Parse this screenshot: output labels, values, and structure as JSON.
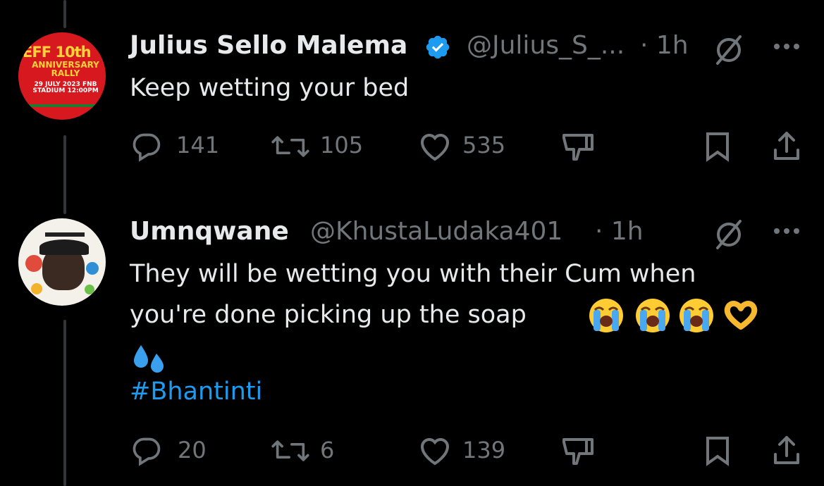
{
  "tweets": [
    {
      "display_name": "Julius Sello Malema",
      "verified": true,
      "handle": "@Julius_S_...",
      "time": "· 1h",
      "text": "Keep wetting your bed",
      "avatar_text": {
        "line1": "EFF 10th",
        "line2": "ANNIVERSARY RALLY",
        "line3": "29 JULY 2023 FNB STADIUM 12:00PM"
      },
      "replies": "141",
      "retweets": "105",
      "likes": "535"
    },
    {
      "display_name": "Umnqwane",
      "verified": false,
      "handle": "@KhustaLudaka401",
      "time": "· 1h",
      "text_line1": "They will be wetting you with their Cum when",
      "text_line2": "you're done picking up the soap",
      "emojis": [
        "loudly-crying-face",
        "loudly-crying-face",
        "loudly-crying-face",
        "heart-hands",
        "sweat-droplets"
      ],
      "hashtag": "#Bhantinti",
      "replies": "20",
      "retweets": "6",
      "likes": "139"
    }
  ],
  "colors": {
    "background": "#000000",
    "text": "#e7e9ea",
    "muted": "#71767b",
    "link": "#1d9bf0",
    "verified": "#1d9bf0",
    "thread_line": "#333639"
  },
  "icons": [
    "reply-icon",
    "retweet-icon",
    "like-icon",
    "dislike-icon",
    "bookmark-icon",
    "share-icon",
    "grok-slash-icon",
    "more-icon",
    "verified-badge-icon"
  ]
}
